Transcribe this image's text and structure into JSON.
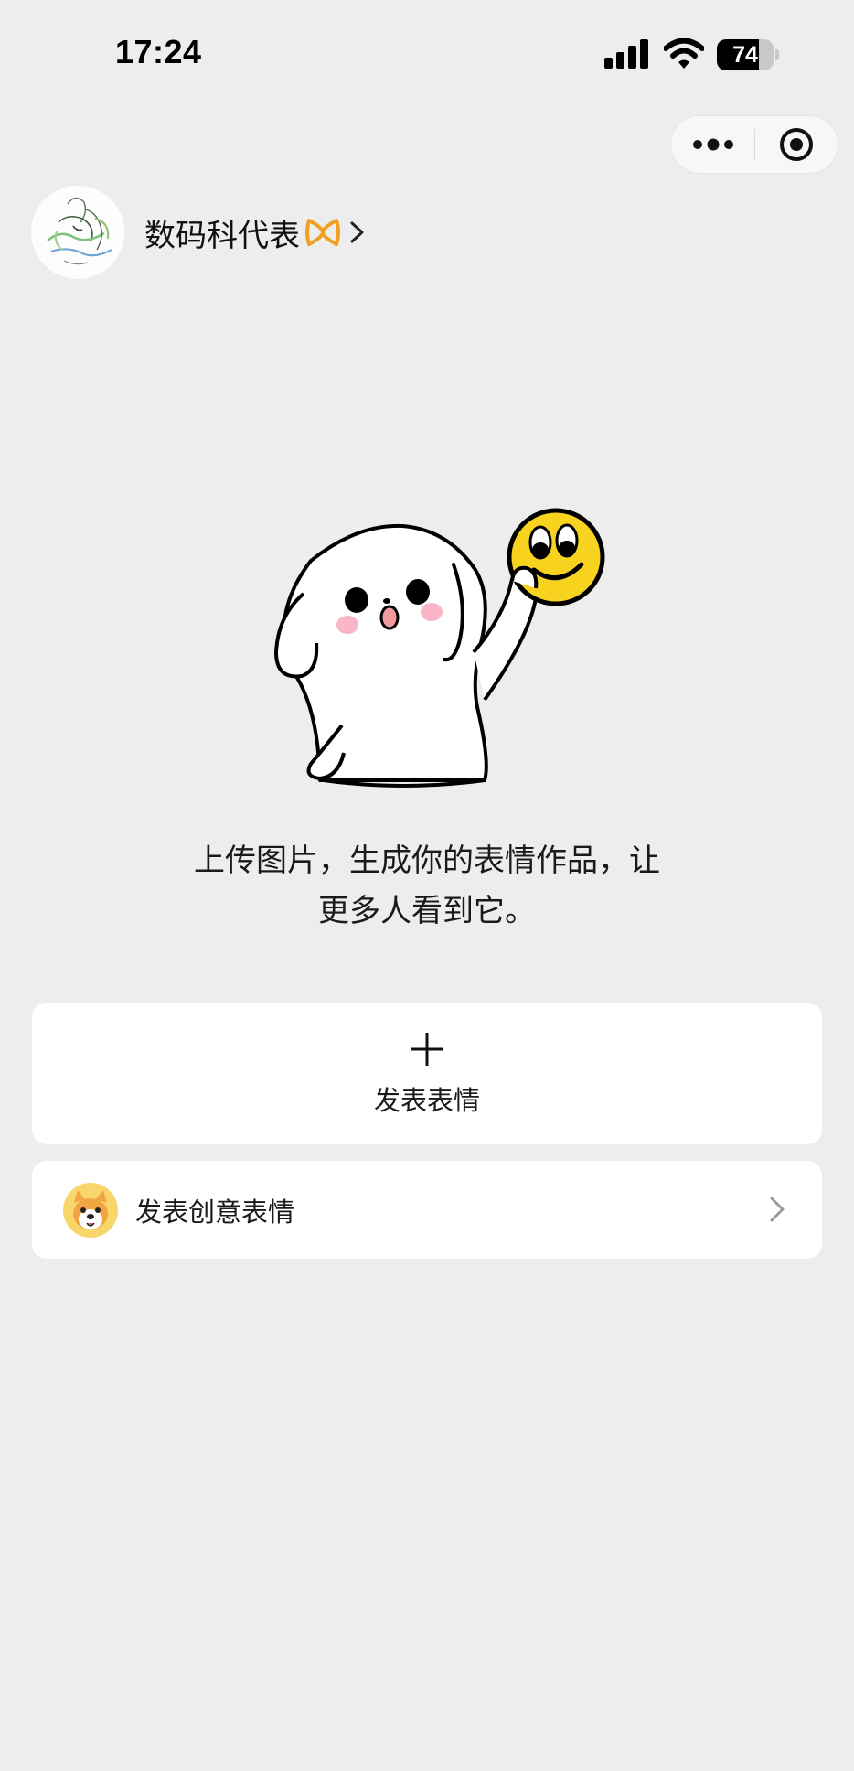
{
  "status_bar": {
    "time": "17:24",
    "battery_level": "74",
    "battery_fraction": 0.74,
    "signal_icon": "cellular-signal-icon",
    "wifi_icon": "wifi-icon"
  },
  "capsule": {
    "more_icon": "more-dots-icon",
    "close_icon": "target-close-icon"
  },
  "profile": {
    "name": "数码科代表",
    "badge_icon": "infinity-badge-icon",
    "chevron_icon": "chevron-right-icon"
  },
  "illustration": {
    "icon": "ghost-holding-smiley-icon"
  },
  "description": {
    "line1": "上传图片，生成你的表情作品，让",
    "line2": "更多人看到它。"
  },
  "publish": {
    "icon": "plus-icon",
    "label": "发表表情"
  },
  "creative": {
    "icon": "shiba-dog-icon",
    "label": "发表创意表情",
    "chevron_icon": "chevron-right-icon"
  },
  "colors": {
    "background": "#ededed",
    "card": "#ffffff",
    "badge_orange": "#f0a020",
    "smiley_yellow": "#f7d21e"
  }
}
